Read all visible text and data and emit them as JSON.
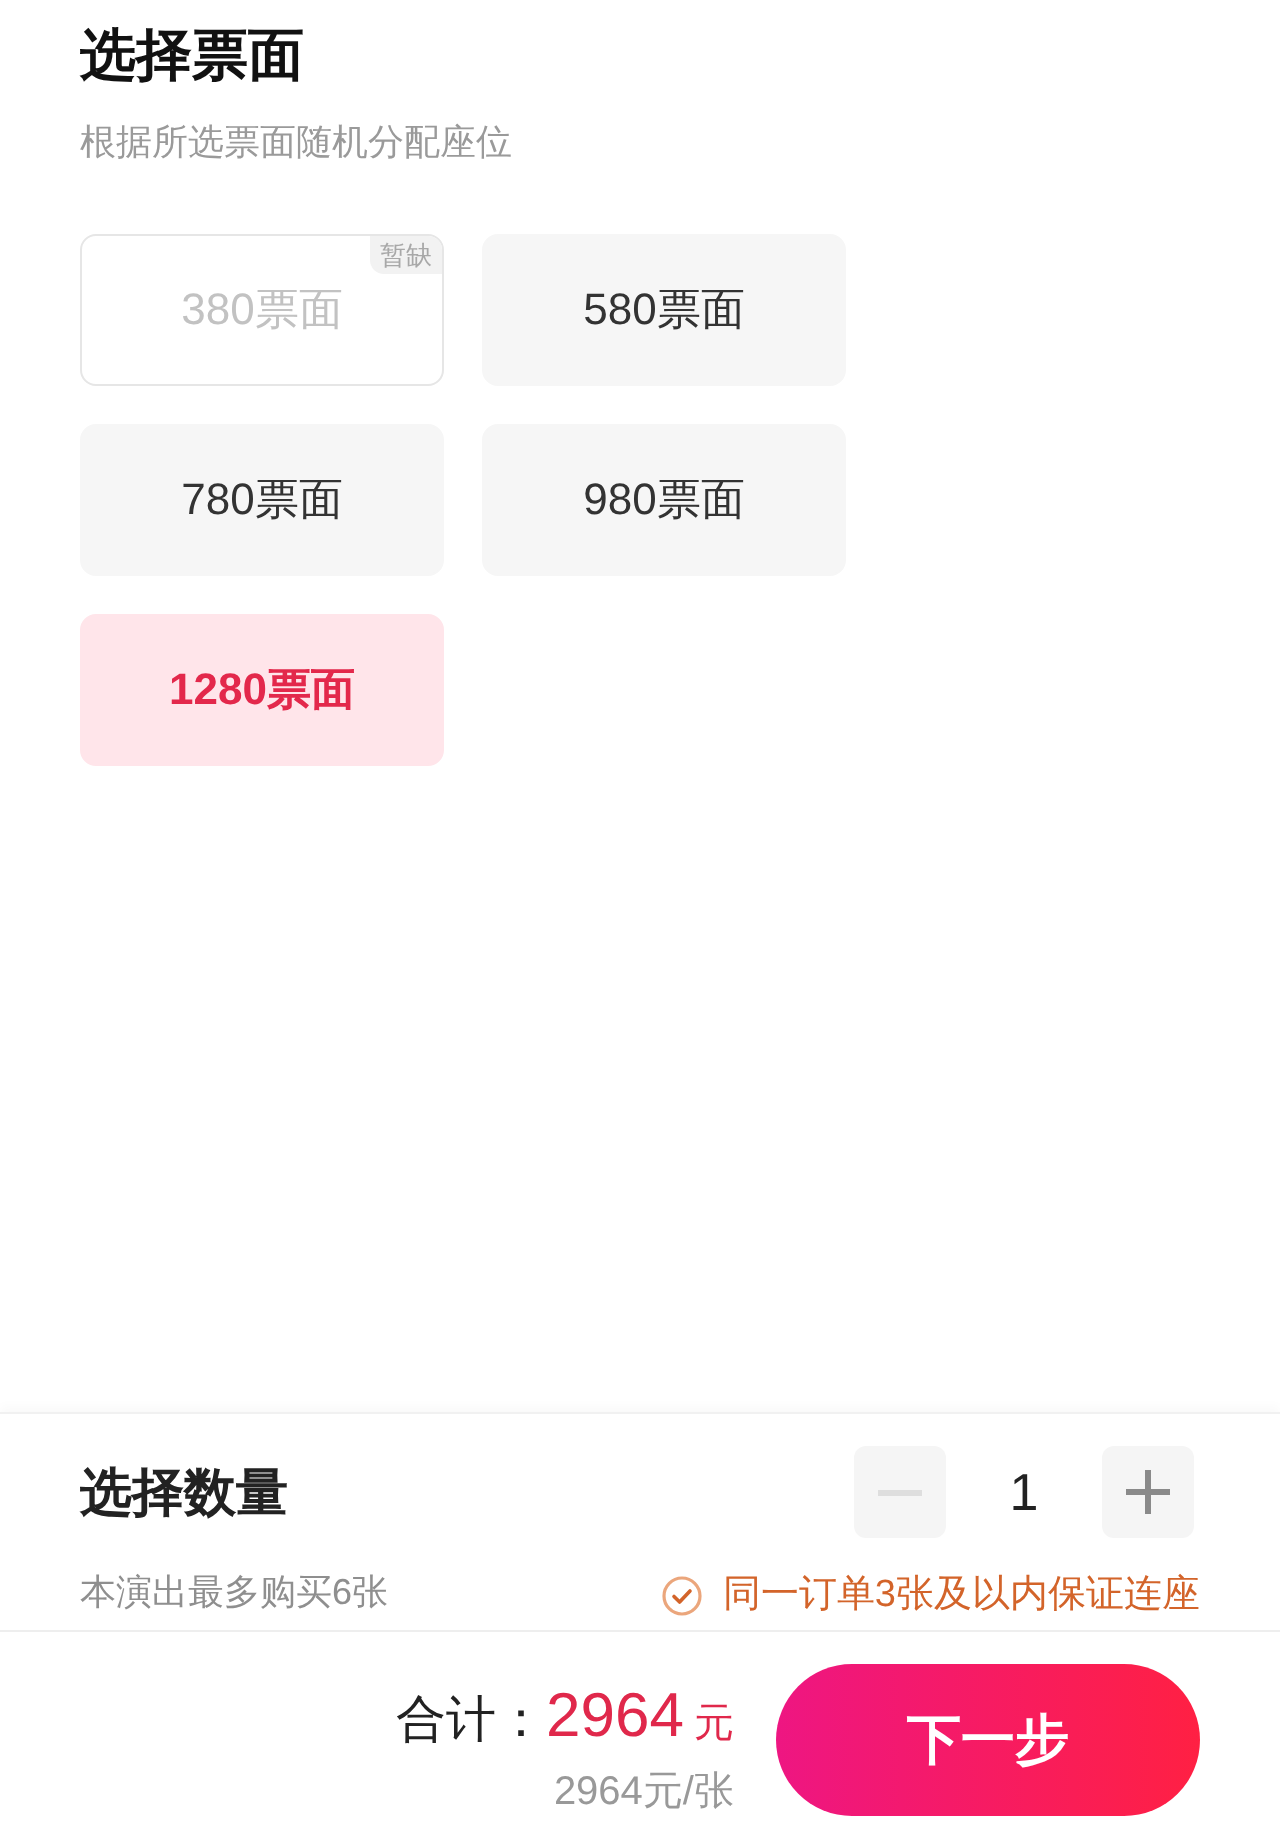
{
  "header": {
    "title": "选择票面",
    "subtitle": "根据所选票面随机分配座位"
  },
  "tickets": [
    {
      "label": "380票面",
      "selected": false,
      "disabled": true,
      "badge": "暂缺"
    },
    {
      "label": "580票面",
      "selected": false,
      "disabled": false
    },
    {
      "label": "780票面",
      "selected": false,
      "disabled": false
    },
    {
      "label": "980票面",
      "selected": false,
      "disabled": false
    },
    {
      "label": "1280票面",
      "selected": true,
      "disabled": false
    }
  ],
  "quantity": {
    "title": "选择数量",
    "note": "本演出最多购买6张",
    "value": "1",
    "decrease": {
      "disabled": true
    },
    "increase": {
      "disabled": false
    },
    "guarantee": "同一订单3张及以内保证连座"
  },
  "footer": {
    "total_label": "合计：",
    "total_amount": "2964",
    "currency": "元",
    "unit_price": "2964元/张",
    "next_button": "下一步"
  }
}
